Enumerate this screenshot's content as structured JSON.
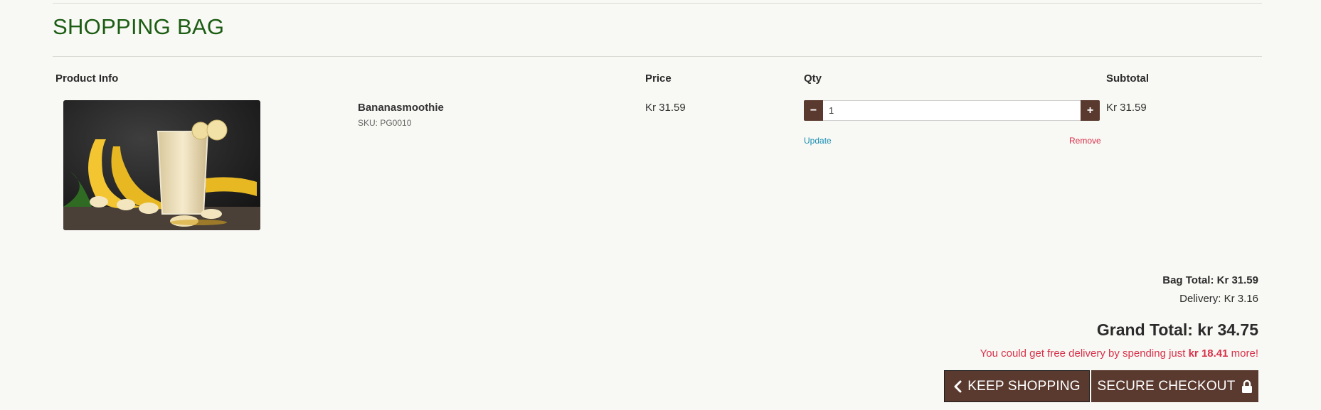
{
  "page": {
    "title": "SHOPPING BAG"
  },
  "table": {
    "headers": {
      "product_info": "Product Info",
      "price": "Price",
      "qty": "Qty",
      "subtotal": "Subtotal"
    }
  },
  "item": {
    "name": "Bananasmoothie",
    "sku": "SKU: PG0010",
    "price": "Kr 31.59",
    "quantity": "1",
    "subtotal": "Kr 31.59",
    "update_label": "Update",
    "remove_label": "Remove",
    "decrement_symbol": "−",
    "increment_symbol": "+"
  },
  "summary": {
    "bag_total": "Bag Total: Kr 31.59",
    "delivery": "Delivery: Kr 3.16",
    "grand_total": "Grand Total: kr 34.75",
    "free_delivery_prefix": "You could get free delivery by spending just ",
    "free_delivery_amount": "kr 18.41",
    "free_delivery_suffix": " more!"
  },
  "actions": {
    "keep_shopping": "KEEP SHOPPING",
    "secure_checkout": "SECURE CHECKOUT"
  },
  "icons": {
    "back": "chevron-left-icon",
    "lock": "lock-icon",
    "product": "smoothie-photo"
  },
  "colors": {
    "brand": "#5a3a2f",
    "title": "#1c5d14",
    "update": "#1a8fb3",
    "alert": "#d9314a"
  }
}
